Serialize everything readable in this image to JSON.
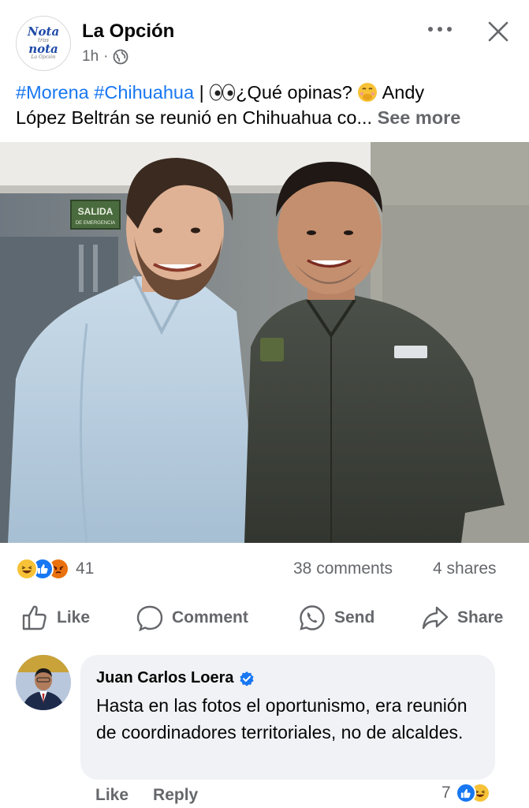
{
  "post": {
    "page_name": "La Opción",
    "time": "1h",
    "time_separator": "·",
    "logo": {
      "line1": "Nota",
      "line2": "tras",
      "line3": "nota",
      "line4": "La Opción"
    },
    "caption": {
      "hashtag1": "#Morena",
      "hashtag2": "#Chihuahua",
      "separator": "|",
      "question": "¿Qué opinas?",
      "text_line1_end": "Andy",
      "text_line2": "López Beltrán se reunió en Chihuahua co...",
      "see_more": "See more"
    },
    "photo": {
      "sign_line1": "SALIDA",
      "sign_line2": "DE EMERGENCIA"
    }
  },
  "stats": {
    "reaction_icons": [
      "haha-icon",
      "like-icon",
      "angry-icon"
    ],
    "reaction_count": "41",
    "comments": "38 comments",
    "shares": "4 shares"
  },
  "actions": {
    "like": "Like",
    "comment": "Comment",
    "send": "Send",
    "share": "Share"
  },
  "comment": {
    "author": "Juan Carlos Loera",
    "text": "Hasta en las fotos el oportunismo, era reunión de coordinadores territoriales, no de alcaldes.",
    "like_label": "Like",
    "reply_label": "Reply",
    "reaction_count": "7"
  },
  "colors": {
    "accent": "#1877f2",
    "secondary_text": "#65676b",
    "bubble_bg": "#f0f2f5"
  }
}
